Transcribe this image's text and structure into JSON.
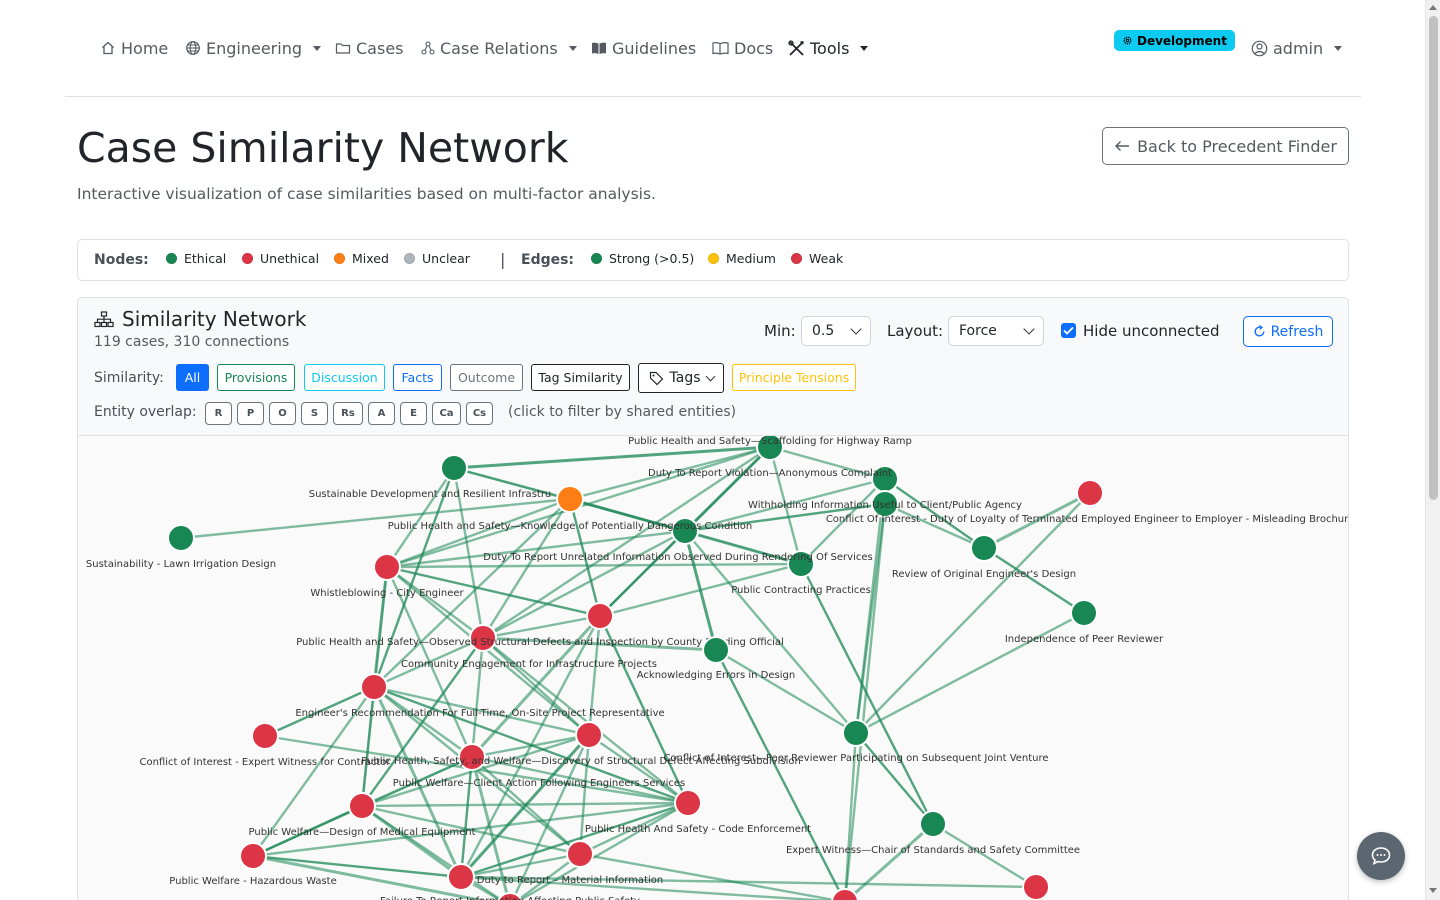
{
  "nav": {
    "home": "Home",
    "engineering": "Engineering",
    "cases": "Cases",
    "case_relations": "Case Relations",
    "guidelines": "Guidelines",
    "docs": "Docs",
    "tools": "Tools",
    "env_badge": "Development",
    "user": "admin"
  },
  "header": {
    "title": "Case Similarity Network",
    "subtitle": "Interactive visualization of case similarities based on multi-factor analysis.",
    "back_button": "Back to Precedent Finder"
  },
  "legend": {
    "nodes_label": "Nodes:",
    "nodes": [
      {
        "label": "Ethical",
        "color": "#198754"
      },
      {
        "label": "Unethical",
        "color": "#dc3545"
      },
      {
        "label": "Mixed",
        "color": "#fd7e14"
      },
      {
        "label": "Unclear",
        "color": "#adb5bd"
      }
    ],
    "separator": "|",
    "edges_label": "Edges:",
    "edges": [
      {
        "label": "Strong (>0.5)",
        "color": "#198754"
      },
      {
        "label": "Medium",
        "color": "#ffc107"
      },
      {
        "label": "Weak",
        "color": "#dc3545"
      }
    ]
  },
  "network": {
    "title": "Similarity Network",
    "stats": "119 cases, 310 connections",
    "min_label": "Min:",
    "min_value": "0.5",
    "layout_label": "Layout:",
    "layout_value": "Force",
    "hide_unconnected": "Hide unconnected",
    "hide_unconnected_checked": true,
    "refresh": "Refresh",
    "similarity_label": "Similarity:",
    "similarity_filters": [
      {
        "label": "All",
        "active": true
      },
      {
        "label": "Provisions"
      },
      {
        "label": "Discussion"
      },
      {
        "label": "Facts"
      },
      {
        "label": "Outcome"
      },
      {
        "label": "Tag Similarity"
      },
      {
        "label": "Tags"
      },
      {
        "label": "Principle Tensions"
      }
    ],
    "entity_label": "Entity overlap:",
    "entity_buttons": [
      "R",
      "P",
      "O",
      "S",
      "Rs",
      "A",
      "E",
      "Ca",
      "Cs"
    ],
    "entity_hint": "(click to filter by shared entities)"
  },
  "graph_nodes": [
    {
      "id": "n1",
      "label": "Public Health and Safety—Scaffolding for Highway Ramp",
      "status": "ethical"
    },
    {
      "id": "n2",
      "label": "",
      "status": "ethical"
    },
    {
      "id": "n3",
      "label": "Duty To Report Violation—Anonymous Complaint",
      "status": "ethical"
    },
    {
      "id": "n4",
      "label": "Sustainable Development and Resilient Infrastru",
      "status": "mixed"
    },
    {
      "id": "n5",
      "label": "Withholding Information Useful to Client/Public Agency",
      "status": "ethical"
    },
    {
      "id": "n6",
      "label": "Conflict Of Interest - Duty of Loyalty of Terminated Employed Engineer to Employer - Misleading Brochure",
      "status": "unethical"
    },
    {
      "id": "n7",
      "label": "Public Health and Safety—Knowledge of Potentially Dangerous Condition",
      "status": "ethical"
    },
    {
      "id": "n8",
      "label": "Sustainability - Lawn Irrigation Design",
      "status": "ethical"
    },
    {
      "id": "n9",
      "label": "Duty To Report Unrelated Information Observed During Rendering Of Services",
      "status": "ethical"
    },
    {
      "id": "n10",
      "label": "Whistleblowing - City Engineer",
      "status": "unethical"
    },
    {
      "id": "n11",
      "label": "Review of Original Engineer's Design",
      "status": "ethical"
    },
    {
      "id": "n12",
      "label": "Public Contracting Practices",
      "status": "unethical"
    },
    {
      "id": "n13",
      "label": "Independence of Peer Reviewer",
      "status": "ethical"
    },
    {
      "id": "n14",
      "label": "Public Health and Safety—Observed Structural Defects and Inspection by County Building Official",
      "status": "unethical"
    },
    {
      "id": "n15",
      "label": "Acknowledging Errors in Design",
      "status": "ethical"
    },
    {
      "id": "n16",
      "label": "Community Engagement for Infrastructure Projects",
      "status": "unethical"
    },
    {
      "id": "n17",
      "label": "Engineer's Recommendation For Full-Time, On-Site Project Representative",
      "status": "unethical"
    },
    {
      "id": "n18",
      "label": "Conflict of Interest - Expert Witness for Contractor",
      "status": "unethical"
    },
    {
      "id": "n19",
      "label": "Public Health, Safety, and Welfare—Discovery of Structural Defect Affecting Subdivision",
      "status": "unethical"
    },
    {
      "id": "n20",
      "label": "Conflict of Interest—Peer Reviewer Participating on Subsequent Joint Venture",
      "status": "ethical"
    },
    {
      "id": "n21",
      "label": "Public Welfare—Client Action Following Engineers Services",
      "status": "unethical"
    },
    {
      "id": "n22",
      "label": "Public Welfare—Design of Medical Equipment",
      "status": "unethical"
    },
    {
      "id": "n23",
      "label": "Public Health And Safety - Code Enforcement",
      "status": "unethical"
    },
    {
      "id": "n24",
      "label": "Expert Witness—Chair of Standards and Safety Committee",
      "status": "ethical"
    },
    {
      "id": "n25",
      "label": "Public Welfare - Hazardous Waste",
      "status": "unethical"
    },
    {
      "id": "n26",
      "label": "Duty to Report – Material Information",
      "status": "unethical"
    },
    {
      "id": "n27",
      "label": "Failure To Report Information Affecting Public Safety",
      "status": "unethical"
    },
    {
      "id": "n28",
      "label": "",
      "status": "unethical"
    },
    {
      "id": "n29",
      "label": "",
      "status": "unethical"
    }
  ],
  "graph_edges": [
    [
      "n2",
      "n1"
    ],
    [
      "n2",
      "n4"
    ],
    [
      "n2",
      "n7"
    ],
    [
      "n2",
      "n10"
    ],
    [
      "n2",
      "n14"
    ],
    [
      "n2",
      "n16"
    ],
    [
      "n1",
      "n4"
    ],
    [
      "n1",
      "n7"
    ],
    [
      "n1",
      "n3"
    ],
    [
      "n1",
      "n10"
    ],
    [
      "n1",
      "n12"
    ],
    [
      "n1",
      "n9"
    ],
    [
      "n1",
      "n14"
    ],
    [
      "n3",
      "n7"
    ],
    [
      "n3",
      "n5"
    ],
    [
      "n3",
      "n11"
    ],
    [
      "n3",
      "n20"
    ],
    [
      "n3",
      "n9"
    ],
    [
      "n4",
      "n7"
    ],
    [
      "n4",
      "n10"
    ],
    [
      "n4",
      "n12"
    ],
    [
      "n4",
      "n9"
    ],
    [
      "n4",
      "n14"
    ],
    [
      "n4",
      "n16"
    ],
    [
      "n4",
      "n8"
    ],
    [
      "n5",
      "n7"
    ],
    [
      "n5",
      "n11"
    ],
    [
      "n5",
      "n20"
    ],
    [
      "n6",
      "n11"
    ],
    [
      "n6",
      "n20"
    ],
    [
      "n11",
      "n13"
    ],
    [
      "n13",
      "n20"
    ],
    [
      "n7",
      "n9"
    ],
    [
      "n7",
      "n12"
    ],
    [
      "n7",
      "n10"
    ],
    [
      "n7",
      "n15"
    ],
    [
      "n7",
      "n20"
    ],
    [
      "n7",
      "n14"
    ],
    [
      "n9",
      "n12"
    ],
    [
      "n9",
      "n10"
    ],
    [
      "n9",
      "n24"
    ],
    [
      "n10",
      "n14"
    ],
    [
      "n10",
      "n16"
    ],
    [
      "n10",
      "n19"
    ],
    [
      "n10",
      "n17"
    ],
    [
      "n10",
      "n12"
    ],
    [
      "n10",
      "n22"
    ],
    [
      "n12",
      "n14"
    ],
    [
      "n12",
      "n17"
    ],
    [
      "n12",
      "n19"
    ],
    [
      "n12",
      "n21"
    ],
    [
      "n12",
      "n26"
    ],
    [
      "n14",
      "n16"
    ],
    [
      "n14",
      "n17"
    ],
    [
      "n14",
      "n19"
    ],
    [
      "n14",
      "n22"
    ],
    [
      "n14",
      "n15"
    ],
    [
      "n14",
      "n21"
    ],
    [
      "n16",
      "n17"
    ],
    [
      "n16",
      "n19"
    ],
    [
      "n16",
      "n21"
    ],
    [
      "n16",
      "n22"
    ],
    [
      "n16",
      "n23"
    ],
    [
      "n16",
      "n26"
    ],
    [
      "n16",
      "n25"
    ],
    [
      "n16",
      "n18"
    ],
    [
      "n17",
      "n19"
    ],
    [
      "n17",
      "n22"
    ],
    [
      "n17",
      "n21"
    ],
    [
      "n17",
      "n23"
    ],
    [
      "n17",
      "n26"
    ],
    [
      "n17",
      "n27"
    ],
    [
      "n19",
      "n21"
    ],
    [
      "n19",
      "n22"
    ],
    [
      "n19",
      "n23"
    ],
    [
      "n19",
      "n26"
    ],
    [
      "n19",
      "n25"
    ],
    [
      "n19",
      "n27"
    ],
    [
      "n21",
      "n22"
    ],
    [
      "n21",
      "n23"
    ],
    [
      "n21",
      "n26"
    ],
    [
      "n21",
      "n25"
    ],
    [
      "n21",
      "n27"
    ],
    [
      "n22",
      "n23"
    ],
    [
      "n22",
      "n26"
    ],
    [
      "n22",
      "n25"
    ],
    [
      "n22",
      "n27"
    ],
    [
      "n23",
      "n26"
    ],
    [
      "n23",
      "n27"
    ],
    [
      "n23",
      "n28"
    ],
    [
      "n25",
      "n26"
    ],
    [
      "n25",
      "n27"
    ],
    [
      "n26",
      "n27"
    ],
    [
      "n26",
      "n28"
    ],
    [
      "n26",
      "n29"
    ],
    [
      "n20",
      "n24"
    ],
    [
      "n20",
      "n15"
    ],
    [
      "n20",
      "n28"
    ],
    [
      "n24",
      "n28"
    ],
    [
      "n24",
      "n29"
    ],
    [
      "n15",
      "n28"
    ],
    [
      "n5",
      "n28"
    ],
    [
      "n18",
      "n21"
    ]
  ]
}
